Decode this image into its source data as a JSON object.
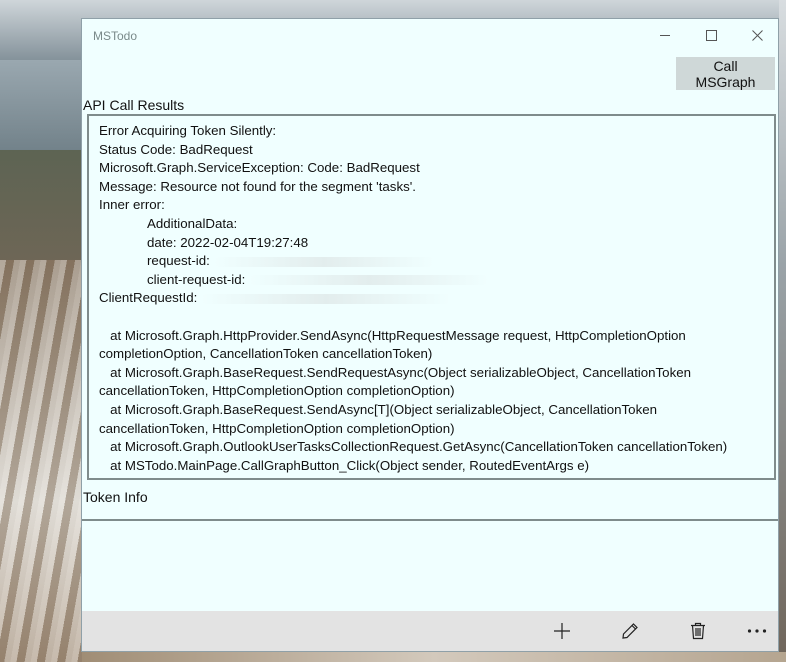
{
  "window": {
    "title": "MSTodo"
  },
  "toolbar": {
    "call_button_label": "Call MSGraph"
  },
  "results": {
    "label": "API Call Results",
    "lines": {
      "l1": "Error Acquiring Token Silently:",
      "l2": "Status Code: BadRequest",
      "l3": "Microsoft.Graph.ServiceException: Code: BadRequest",
      "l4": "Message: Resource not found for the segment 'tasks'.",
      "l5": "Inner error:",
      "l6": "AdditionalData:",
      "l7": "date: 2022-02-04T19:27:48",
      "l8": "request-id:",
      "l9": "client-request-id:",
      "l10": "ClientRequestId:",
      "l11": "   at Microsoft.Graph.HttpProvider.SendAsync(HttpRequestMessage request, HttpCompletionOption completionOption, CancellationToken cancellationToken)",
      "l12": "   at Microsoft.Graph.BaseRequest.SendRequestAsync(Object serializableObject, CancellationToken cancellationToken, HttpCompletionOption completionOption)",
      "l13": "   at Microsoft.Graph.BaseRequest.SendAsync[T](Object serializableObject, CancellationToken cancellationToken, HttpCompletionOption completionOption)",
      "l14": "   at Microsoft.Graph.OutlookUserTasksCollectionRequest.GetAsync(CancellationToken cancellationToken)",
      "l15": "   at MSTodo.MainPage.CallGraphButton_Click(Object sender, RoutedEventArgs e)"
    }
  },
  "token": {
    "label": "Token Info"
  },
  "commandbar": {
    "icons": [
      "add-icon",
      "edit-icon",
      "delete-icon",
      "more-icon"
    ]
  }
}
